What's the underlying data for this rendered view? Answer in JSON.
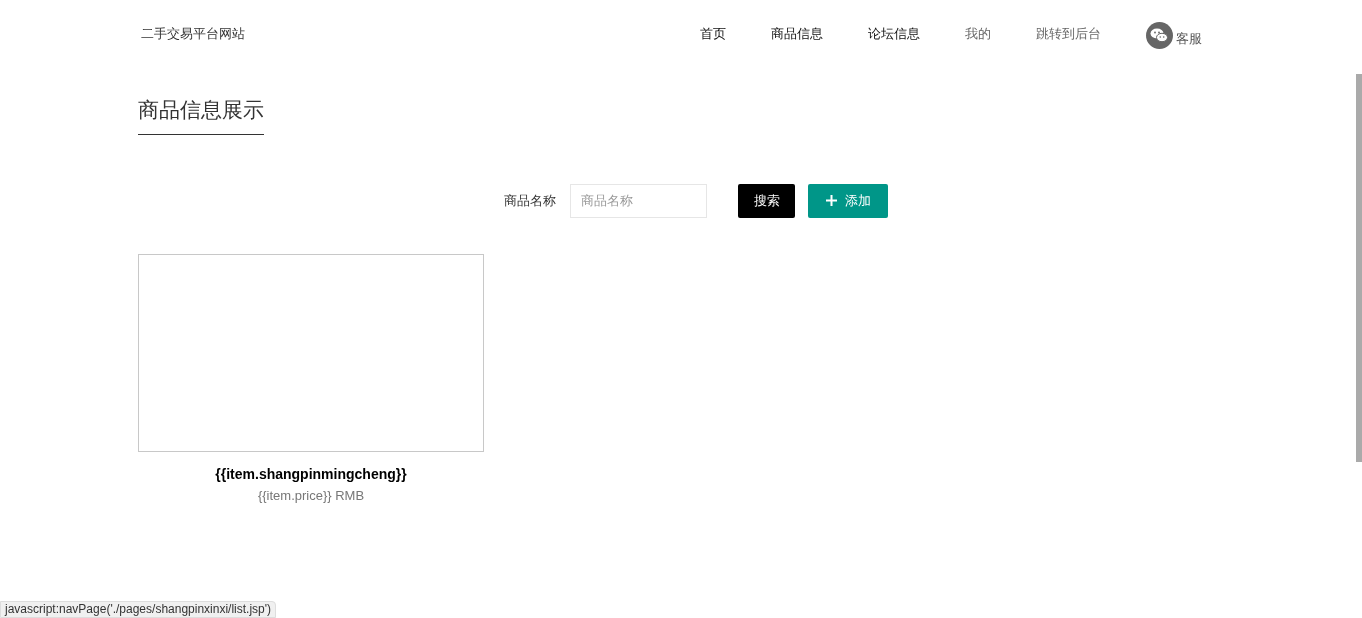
{
  "site_title": "二手交易平台网站",
  "nav": [
    {
      "label": "首页",
      "muted": false
    },
    {
      "label": "商品信息",
      "muted": false
    },
    {
      "label": "论坛信息",
      "muted": false
    },
    {
      "label": "我的",
      "muted": true
    },
    {
      "label": "跳转到后台",
      "muted": true
    }
  ],
  "service": {
    "label": "客服"
  },
  "heading": "商品信息展示",
  "search": {
    "label": "商品名称",
    "placeholder": "商品名称",
    "search_button": "搜索",
    "add_button": "添加"
  },
  "products": [
    {
      "name": "{{item.shangpinmingcheng}}",
      "price": "{{item.price}} RMB"
    }
  ],
  "status_url": "javascript:navPage('./pages/shangpinxinxi/list.jsp')"
}
